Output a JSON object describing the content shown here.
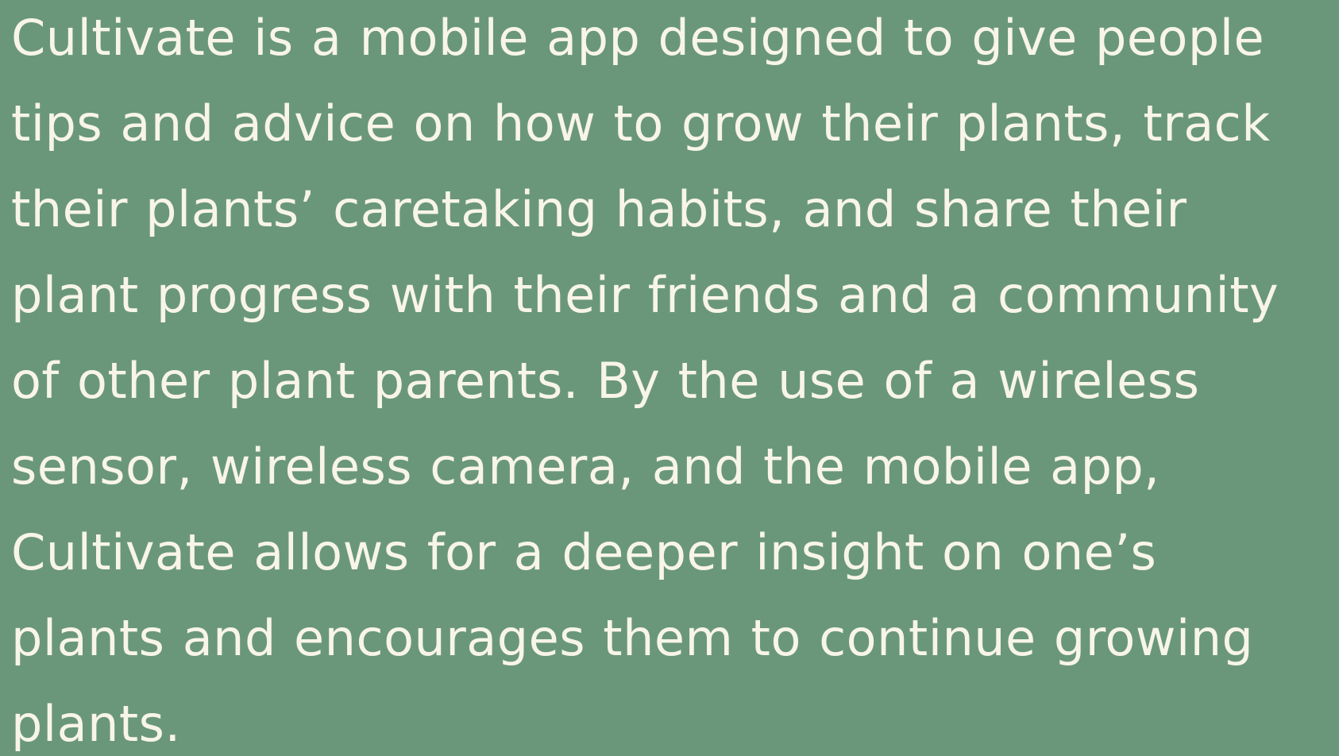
{
  "background_color": "#6a977a",
  "text_color": "#f8f5e8",
  "description": "Cultivate is a mobile app designed to give people\ntips and advice on how to grow their plants, track\ntheir plants’ caretaking habits, and share their\nplant progress with their friends and a community\nof other plant parents. By the use of a wireless\nsensor, wireless camera, and the mobile app,\nCultivate allows for a deeper insight on one’s\nplants and encourages them to continue growing\nplants."
}
